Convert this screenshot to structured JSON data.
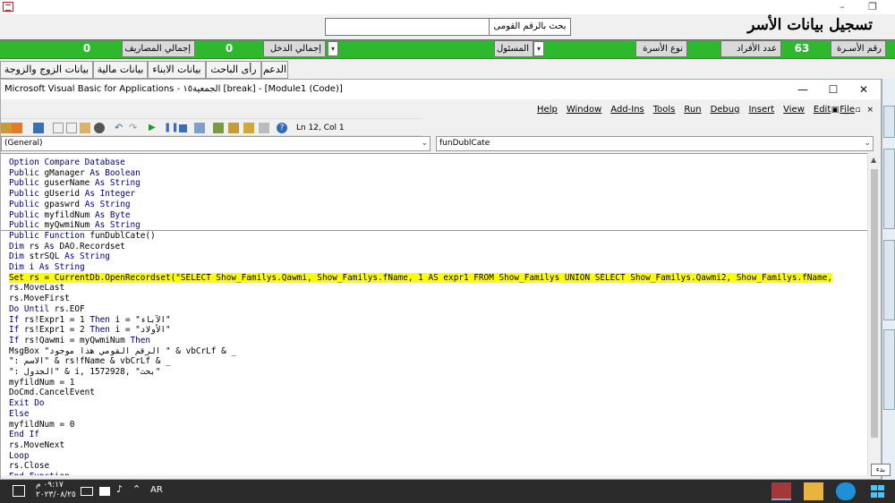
{
  "access": {
    "form_title": "تسجيل بيانات الأسر",
    "search_label": "بحث بالرقم القومى",
    "search_value": "",
    "window_controls": {
      "minimize": "–",
      "restore": "❐"
    },
    "stats": {
      "family_number_label": "رقم الأسـرة",
      "family_number_value": "63",
      "members_label": "عدد الأفراد",
      "members_value": "",
      "family_type_label": "نوع الأسرة",
      "family_type_value": "",
      "responsible_label": "المسئول",
      "responsible_value": "",
      "total_income_label": "إجمالي الدخل",
      "total_income_value": "0",
      "total_expenses_label": "إجمالي المصاريف",
      "total_expenses_value": "0"
    },
    "tabs": [
      "الدعم",
      "رأى الباحث",
      "بيانات الابناء",
      "بيانات مالية",
      "بيانات الزوج والزوجة"
    ],
    "colors": {
      "stats_bar": "#2eb82e"
    }
  },
  "vba": {
    "title": "Microsoft Visual Basic for Applications - الجمعية١٥ [break] - [Module1 (Code)]",
    "window_controls": {
      "minimize": "—",
      "maximize": "☐",
      "close": "✕"
    },
    "menu": [
      "File",
      "Edit",
      "View",
      "Insert",
      "Debug",
      "Run",
      "Tools",
      "Add-Ins",
      "Window",
      "Help"
    ],
    "cursor_position": "Ln 12, Col 1",
    "object_combo": "(General)",
    "procedure_combo": "funDublCate",
    "code": [
      [
        [
          "kw",
          "Option Compare Database"
        ]
      ],
      [
        [
          "kw",
          "Public"
        ],
        [
          "t",
          " gManager "
        ],
        [
          "kw",
          "As Boolean"
        ]
      ],
      [
        [
          "kw",
          "Public"
        ],
        [
          "t",
          " guserName "
        ],
        [
          "kw",
          "As String"
        ]
      ],
      [
        [
          "kw",
          "Public"
        ],
        [
          "t",
          " gUserid "
        ],
        [
          "kw",
          "As Integer"
        ]
      ],
      [
        [
          "kw",
          "Public"
        ],
        [
          "t",
          " gpaswrd "
        ],
        [
          "kw",
          "As String"
        ]
      ],
      [
        [
          "kw",
          "Public"
        ],
        [
          "t",
          " myfildNum "
        ],
        [
          "kw",
          "As Byte"
        ]
      ],
      [
        [
          "kw",
          "Public"
        ],
        [
          "t",
          " myQwmiNum "
        ],
        [
          "kw",
          "As String"
        ]
      ],
      [
        [
          "kw",
          "Public Function"
        ],
        [
          "t",
          " funDublCate()"
        ]
      ],
      [
        [
          "kw",
          "Dim"
        ],
        [
          "t",
          " rs "
        ],
        [
          "kw",
          "As"
        ],
        [
          "t",
          " DAO.Recordset"
        ]
      ],
      [
        [
          "kw",
          "Dim"
        ],
        [
          "t",
          " strSQL "
        ],
        [
          "kw",
          "As String"
        ]
      ],
      [
        [
          "kw",
          "Dim"
        ],
        [
          "t",
          " i "
        ],
        [
          "kw",
          "As String"
        ]
      ],
      [
        [
          "hl",
          "Set rs = CurrentDb.OpenRecordset(\"SELECT Show_Familys.Qawmi, Show_Familys.fName, 1 AS expr1 FROM Show_Familys UNION SELECT Show_Familys.Qawmi2, Show_Familys.fName,"
        ]
      ],
      [
        [
          "t",
          "rs.MoveLast"
        ]
      ],
      [
        [
          "t",
          "rs.MoveFirst"
        ]
      ],
      [
        [
          "kw",
          "Do Until"
        ],
        [
          "t",
          " rs.EOF"
        ]
      ],
      [
        [
          "kw",
          "If"
        ],
        [
          "t",
          " rs!Expr1 = 1 "
        ],
        [
          "kw",
          "Then"
        ],
        [
          "t",
          " i = \"الآباء\""
        ]
      ],
      [
        [
          "kw",
          "If"
        ],
        [
          "t",
          " rs!Expr1 = 2 "
        ],
        [
          "kw",
          "Then"
        ],
        [
          "t",
          " i = \"الأولاد\""
        ]
      ],
      [
        [
          "kw",
          "If"
        ],
        [
          "t",
          " rs!Qawmi = myQwmiNum "
        ],
        [
          "kw",
          "Then"
        ]
      ],
      [
        [
          "t",
          "MsgBox \"الرقم القومي هذا موجود \" & vbCrLf & _"
        ]
      ],
      [
        [
          "t",
          "\": الاسم\" & rs!fName & vbCrLf & _"
        ]
      ],
      [
        [
          "t",
          "\": الجدول\" & i, 1572928, \"بحث\""
        ]
      ],
      [
        [
          "t",
          "myfildNum = 1"
        ]
      ],
      [
        [
          "t",
          "DoCmd.CancelEvent"
        ]
      ],
      [
        [
          "kw",
          "Exit Do"
        ]
      ],
      [
        [
          "kw",
          "Else"
        ]
      ],
      [
        [
          "t",
          "myfildNum = 0"
        ]
      ],
      [
        [
          "kw",
          "End If"
        ]
      ],
      [
        [
          "t",
          "rs.MoveNext"
        ]
      ],
      [
        [
          "kw",
          "Loop"
        ]
      ],
      [
        [
          "t",
          "rs.Close"
        ]
      ],
      [
        [
          "kw",
          "End Function"
        ]
      ]
    ],
    "colors": {
      "keyword": "#00008b",
      "highlight": "#ffff00"
    }
  },
  "tooltip": "بدء",
  "taskbar": {
    "time": "٠٩:١٧ م",
    "date": "٢٠٢٣/٠٨/٢٥",
    "language": "AR",
    "apps": [
      "access-icon",
      "file-explorer-icon",
      "edge-icon",
      "windows-start-icon"
    ]
  }
}
